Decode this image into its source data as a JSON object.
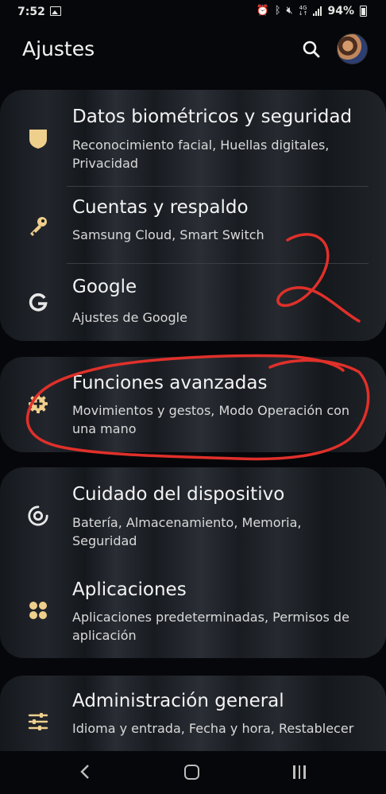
{
  "status_bar": {
    "time": "7:52",
    "network_label": "4G",
    "battery_percent": "94%"
  },
  "header": {
    "title": "Ajustes"
  },
  "sections": [
    {
      "items": [
        {
          "icon": "shield-icon",
          "title": "Datos biométricos y seguridad",
          "subtitle": "Reconocimiento facial, Huellas digitales, Privacidad"
        },
        {
          "icon": "key-icon",
          "title": "Cuentas y respaldo",
          "subtitle": "Samsung Cloud, Smart Switch"
        },
        {
          "icon": "google-icon",
          "title": "Google",
          "subtitle": "Ajustes de Google"
        }
      ]
    },
    {
      "items": [
        {
          "icon": "gear-plus-icon",
          "title": "Funciones avanzadas",
          "subtitle": "Movimientos y gestos, Modo Operación con una mano"
        }
      ]
    },
    {
      "items": [
        {
          "icon": "device-care-icon",
          "title": "Cuidado del dispositivo",
          "subtitle": "Batería, Almacenamiento, Memoria, Seguridad"
        },
        {
          "icon": "apps-icon",
          "title": "Aplicaciones",
          "subtitle": "Aplicaciones predeterminadas, Permisos de aplicación"
        }
      ]
    },
    {
      "items": [
        {
          "icon": "sliders-icon",
          "title": "Administración general",
          "subtitle": "Idioma y entrada, Fecha y hora, Restablecer"
        }
      ]
    }
  ],
  "annotation": {
    "number": "2",
    "color": "#e0302a"
  },
  "colors": {
    "icon_accent": "#efcf8c"
  }
}
